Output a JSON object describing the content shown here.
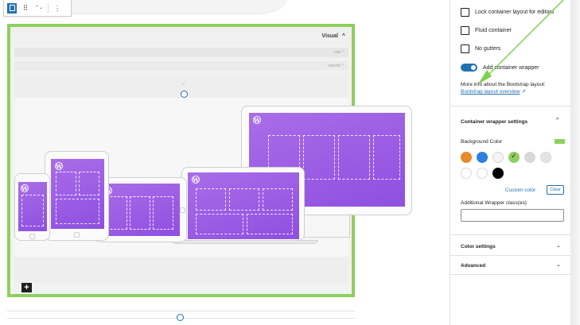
{
  "toolbar": {
    "column_icon": "columns-icon",
    "drag_icon": "drag-handle-icon",
    "move_icon": "move-up-down-icon",
    "more_icon": "more-options-icon",
    "drag_glyph": "⠿",
    "move_glyph": "⌃⌄",
    "more_glyph": "⋮"
  },
  "canvas": {
    "visual_label": "Visual",
    "visual_chevron": "^",
    "row_label": "row ^",
    "column_label": "column ^",
    "check_glyph": "✓",
    "add_block_glyph": "+",
    "border_color": "#8fcf5e",
    "screen_color": "#9b5de5"
  },
  "sidebar": {
    "options": [
      {
        "label": "Lock container layout for editors",
        "checked": false
      },
      {
        "label": "Fluid container",
        "checked": false
      },
      {
        "label": "No gutters",
        "checked": false
      }
    ],
    "toggle": {
      "label": "Add container wrapper",
      "on": true
    },
    "info_text": "More info about the Bootstrap layout:",
    "info_link": "Bootstrap layout overview",
    "info_link_icon": "↗",
    "wrapper_panel": {
      "title": "Container wrapper settings",
      "chevron": "^",
      "bg_label": "Background Color",
      "swatch_colors": [
        "#e8892b",
        "#2f7fe0",
        "#f4f4f4",
        "#8fcf5e",
        "#d9d9d9",
        "#e4e4e4",
        "#ffffff",
        "#ffffff",
        "#000000"
      ],
      "selected_swatch": 3,
      "custom_color": "Custom color",
      "clear": "Clear",
      "additional_label": "Additional Wrapper class(es)",
      "additional_value": ""
    },
    "color_settings": {
      "title": "Color settings",
      "chevron": "⌄"
    },
    "advanced": {
      "title": "Advanced",
      "chevron": "⌄"
    }
  },
  "accent": "#2271b1",
  "arrow_color": "#7bd24a"
}
